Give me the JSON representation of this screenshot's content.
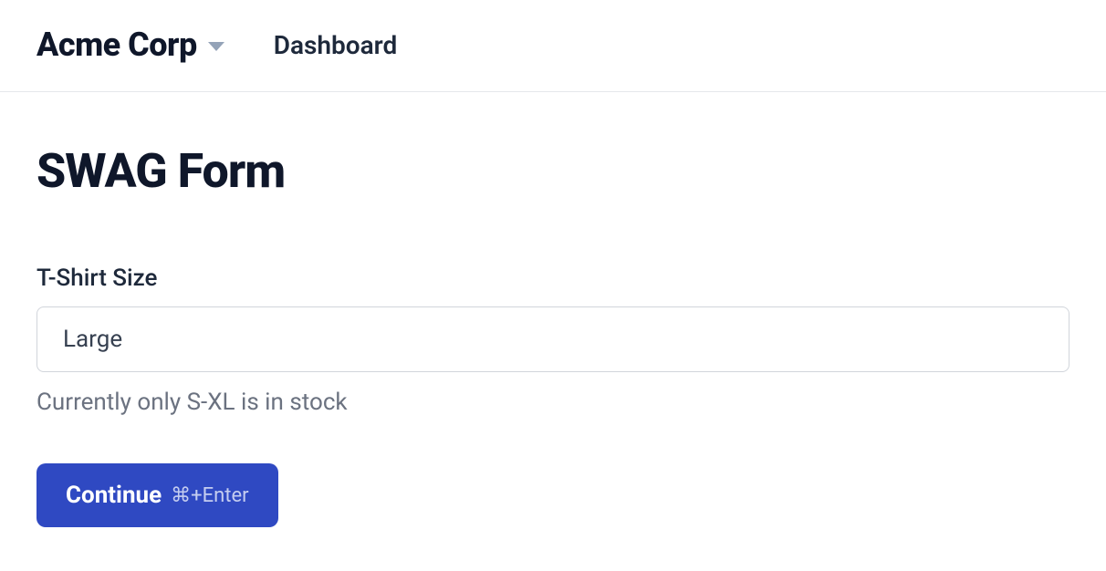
{
  "header": {
    "org_name": "Acme Corp",
    "nav_dashboard": "Dashboard"
  },
  "page": {
    "title": "SWAG Form"
  },
  "form": {
    "tshirt": {
      "label": "T-Shirt Size",
      "value": "Large",
      "help": "Currently only S-XL is in stock"
    },
    "submit": {
      "label": "Continue",
      "shortcut": "⌘+Enter"
    }
  }
}
